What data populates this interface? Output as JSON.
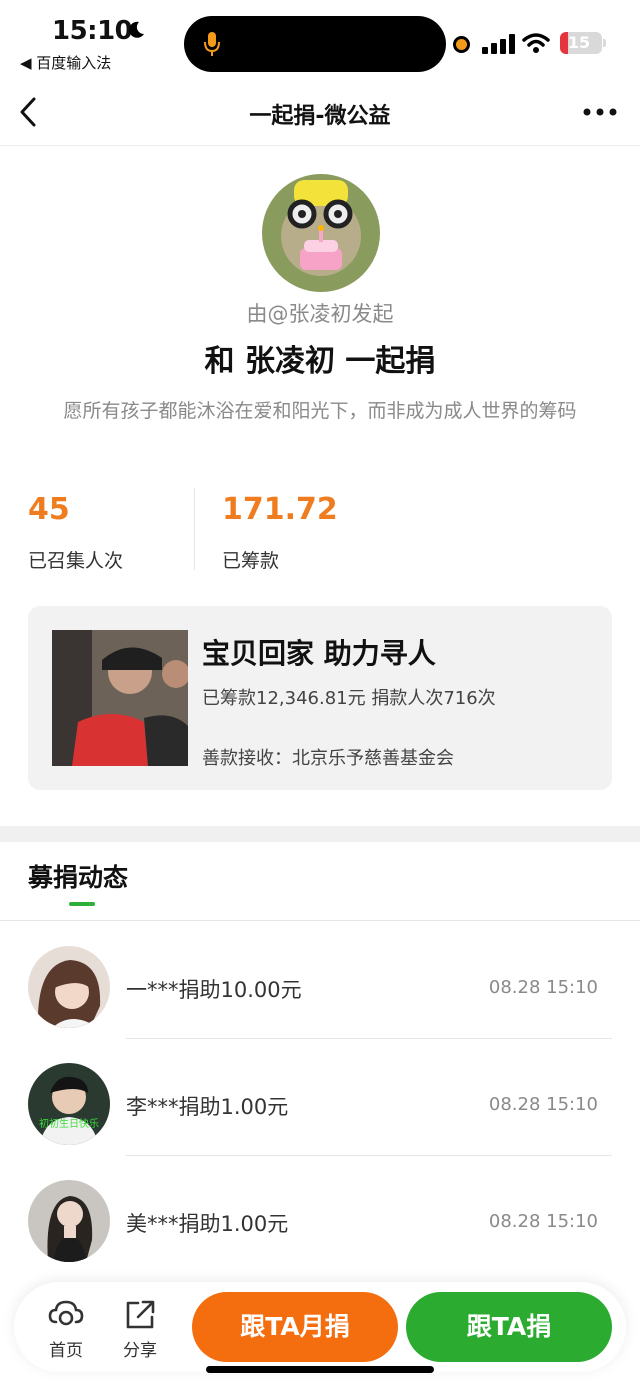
{
  "status_bar": {
    "time": "15:10",
    "back_app": "◀ 百度输入法",
    "battery": "15",
    "colors": {
      "battery_low": "#e5343b",
      "mic": "#f49a1a"
    }
  },
  "nav": {
    "title": "一起捐-微公益",
    "back_icon": "chevron-left-icon",
    "more_icon": "more-dots-icon"
  },
  "profile": {
    "initiator": "由@张凌初发起",
    "headline": "和 张凌初 一起捐",
    "slogan": "愿所有孩子都能沐浴在爱和阳光下，而非成为成人世界的筹码"
  },
  "stats": {
    "participants_value": "45",
    "participants_label": "已召集人次",
    "raised_value": "171.72",
    "raised_label": "已筹款",
    "accent_color": "#ef7d1f"
  },
  "project": {
    "title": "宝贝回家 助力寻人",
    "raised_info": "已筹款12,346.81元  捐款人次716次",
    "recipient": "善款接收：北京乐予慈善基金会"
  },
  "feed": {
    "title": "募捐动态",
    "rows": [
      {
        "text": "一***捐助10.00元",
        "time": "08.28 15:10"
      },
      {
        "text": "李***捐助1.00元",
        "time": "08.28 15:10",
        "avatar_caption": "初初生日快乐"
      },
      {
        "text": "美***捐助1.00元",
        "time": "08.28 15:10"
      }
    ]
  },
  "bottom": {
    "home_label": "首页",
    "share_label": "分享",
    "monthly_button": "跟TA月捐",
    "donate_button": "跟TA捐",
    "colors": {
      "monthly": "#f46d0e",
      "donate": "#2bab2f"
    }
  }
}
